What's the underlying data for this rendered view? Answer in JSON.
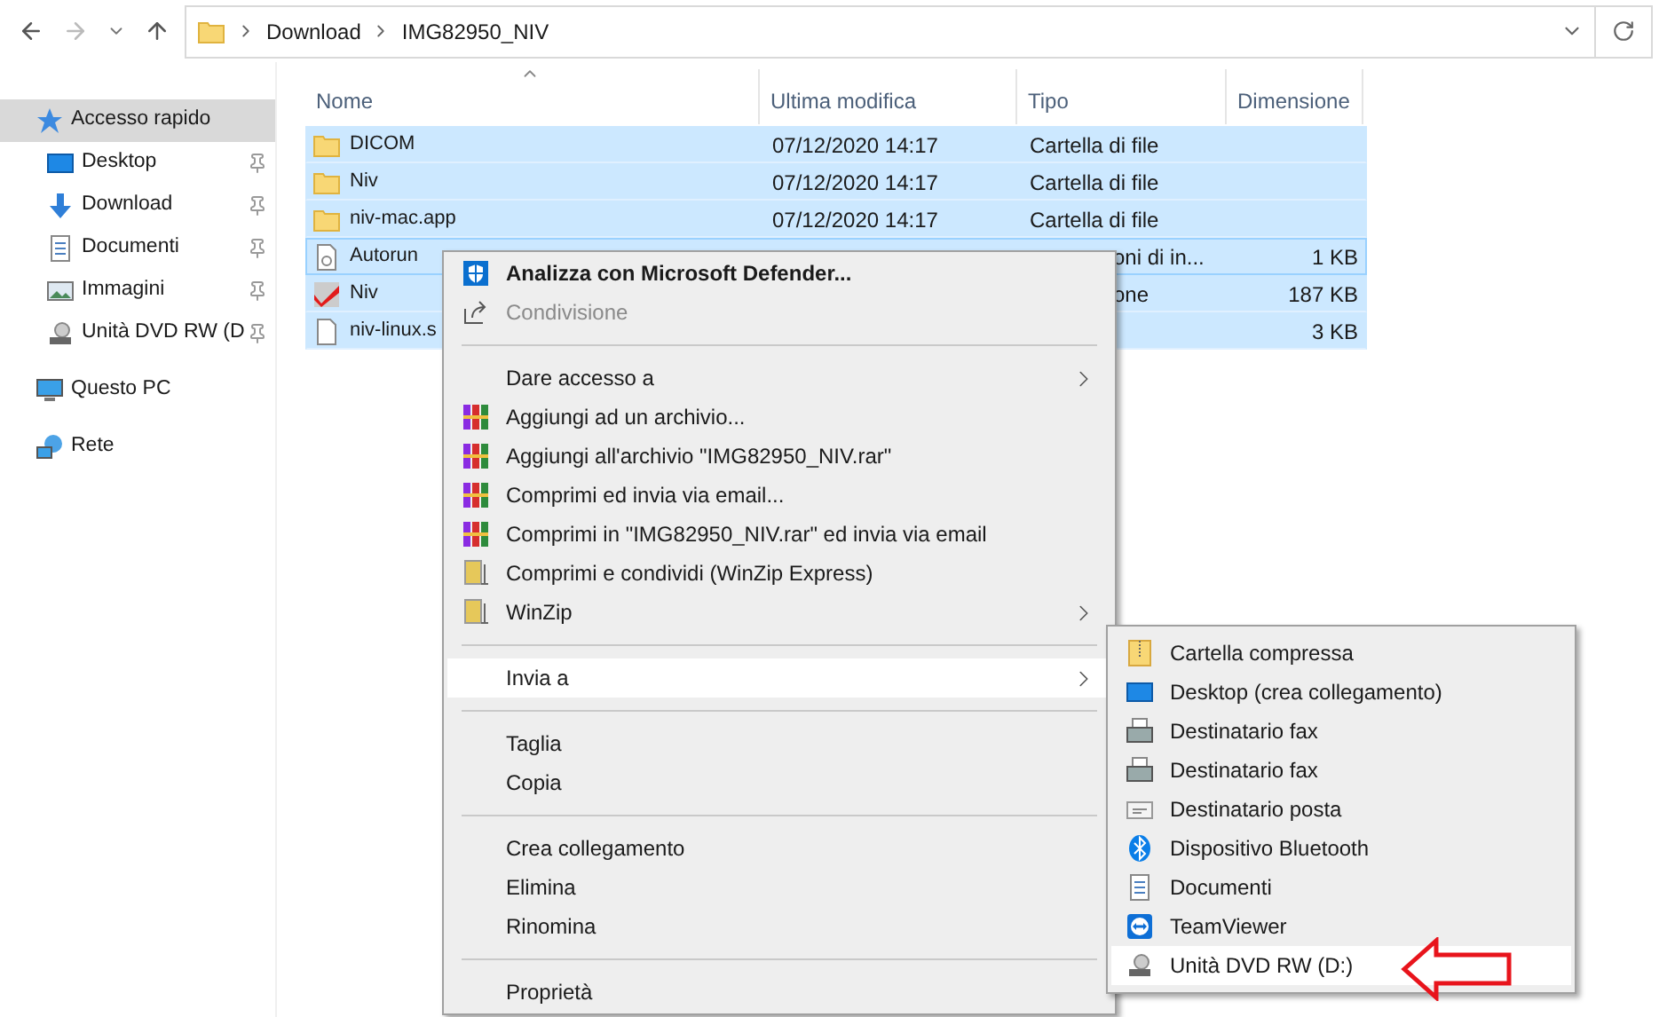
{
  "address_bar": {
    "path": [
      "Download",
      "IMG82950_NIV"
    ]
  },
  "sidebar": {
    "items": [
      {
        "label": "Accesso rapido",
        "selected": true,
        "pinned": false,
        "children": [
          {
            "label": "Desktop",
            "selected": false,
            "pinned": true
          },
          {
            "label": "Download",
            "selected": false,
            "pinned": true
          },
          {
            "label": "Documenti",
            "selected": false,
            "pinned": true
          },
          {
            "label": "Immagini",
            "selected": false,
            "pinned": true
          },
          {
            "label": "Unità DVD RW (D",
            "selected": false,
            "pinned": true
          }
        ]
      },
      {
        "label": "Questo PC",
        "selected": false,
        "pinned": false
      },
      {
        "label": "Rete",
        "selected": false,
        "pinned": false
      }
    ]
  },
  "table": {
    "columns": [
      "Nome",
      "Ultima modifica",
      "Tipo",
      "Dimensione"
    ],
    "rows": [
      {
        "kind": "folder",
        "name": "DICOM",
        "modified": "07/12/2020 14:17",
        "type": "Cartella di file",
        "selected": true,
        "focused": false
      },
      {
        "kind": "folder",
        "name": "Niv",
        "modified": "07/12/2020 14:17",
        "type": "Cartella di file",
        "selected": true,
        "focused": false
      },
      {
        "kind": "folder",
        "name": "niv-mac.app",
        "modified": "07/12/2020 14:17",
        "type": "Cartella di file",
        "selected": true,
        "focused": false
      },
      {
        "kind": "config",
        "name": "Autorun",
        "type": "oni di in...",
        "size": "1 KB",
        "selected": true,
        "focused": true
      },
      {
        "kind": "app",
        "name": "Niv",
        "type": "one",
        "size": "187 KB",
        "selected": true,
        "focused": false
      },
      {
        "kind": "text",
        "name": "niv-linux.s",
        "size": "3 KB",
        "selected": true,
        "focused": false
      }
    ]
  },
  "context_menu": {
    "items": [
      {
        "kind": "item",
        "label": "Analizza con Microsoft Defender...",
        "bold": true,
        "disabled": false,
        "submenu": false,
        "selected": false
      },
      {
        "kind": "item",
        "label": "Condivisione",
        "bold": false,
        "disabled": true,
        "submenu": false,
        "selected": false
      },
      {
        "kind": "separator"
      },
      {
        "kind": "item",
        "label": "Dare accesso a",
        "bold": false,
        "disabled": false,
        "submenu": true,
        "selected": false
      },
      {
        "kind": "item",
        "label": "Aggiungi ad un archivio...",
        "bold": false,
        "disabled": false,
        "submenu": false,
        "selected": false
      },
      {
        "kind": "item",
        "label": "Aggiungi all'archivio \"IMG82950_NIV.rar\"",
        "bold": false,
        "disabled": false,
        "submenu": false,
        "selected": false
      },
      {
        "kind": "item",
        "label": "Comprimi ed invia via email...",
        "bold": false,
        "disabled": false,
        "submenu": false,
        "selected": false
      },
      {
        "kind": "item",
        "label": "Comprimi in \"IMG82950_NIV.rar\" ed invia via email",
        "bold": false,
        "disabled": false,
        "submenu": false,
        "selected": false
      },
      {
        "kind": "item",
        "label": "Comprimi e condividi (WinZip Express)",
        "bold": false,
        "disabled": false,
        "submenu": false,
        "selected": false
      },
      {
        "kind": "item",
        "label": "WinZip",
        "bold": false,
        "disabled": false,
        "submenu": true,
        "selected": false
      },
      {
        "kind": "separator"
      },
      {
        "kind": "item",
        "label": "Invia a",
        "bold": false,
        "disabled": false,
        "submenu": true,
        "selected": true
      },
      {
        "kind": "separator"
      },
      {
        "kind": "item",
        "label": "Taglia",
        "bold": false,
        "disabled": false,
        "submenu": false,
        "selected": false
      },
      {
        "kind": "item",
        "label": "Copia",
        "bold": false,
        "disabled": false,
        "submenu": false,
        "selected": false
      },
      {
        "kind": "separator"
      },
      {
        "kind": "item",
        "label": "Crea collegamento",
        "bold": false,
        "disabled": false,
        "submenu": false,
        "selected": false
      },
      {
        "kind": "item",
        "label": "Elimina",
        "bold": false,
        "disabled": false,
        "submenu": false,
        "selected": false
      },
      {
        "kind": "item",
        "label": "Rinomina",
        "bold": false,
        "disabled": false,
        "submenu": false,
        "selected": false
      },
      {
        "kind": "separator"
      },
      {
        "kind": "item",
        "label": "Proprietà",
        "bold": false,
        "disabled": false,
        "submenu": false,
        "selected": false
      }
    ]
  },
  "send_to_menu": {
    "items": [
      {
        "label": "Cartella compressa",
        "selected": false
      },
      {
        "label": "Desktop (crea collegamento)",
        "selected": false
      },
      {
        "label": "Destinatario fax",
        "selected": false
      },
      {
        "label": "Destinatario fax",
        "selected": false
      },
      {
        "label": "Destinatario posta",
        "selected": false
      },
      {
        "label": "Dispositivo Bluetooth",
        "selected": false
      },
      {
        "label": "Documenti",
        "selected": false
      },
      {
        "label": "TeamViewer",
        "selected": false
      },
      {
        "label": "Unità DVD RW (D:)",
        "selected": true
      }
    ]
  }
}
